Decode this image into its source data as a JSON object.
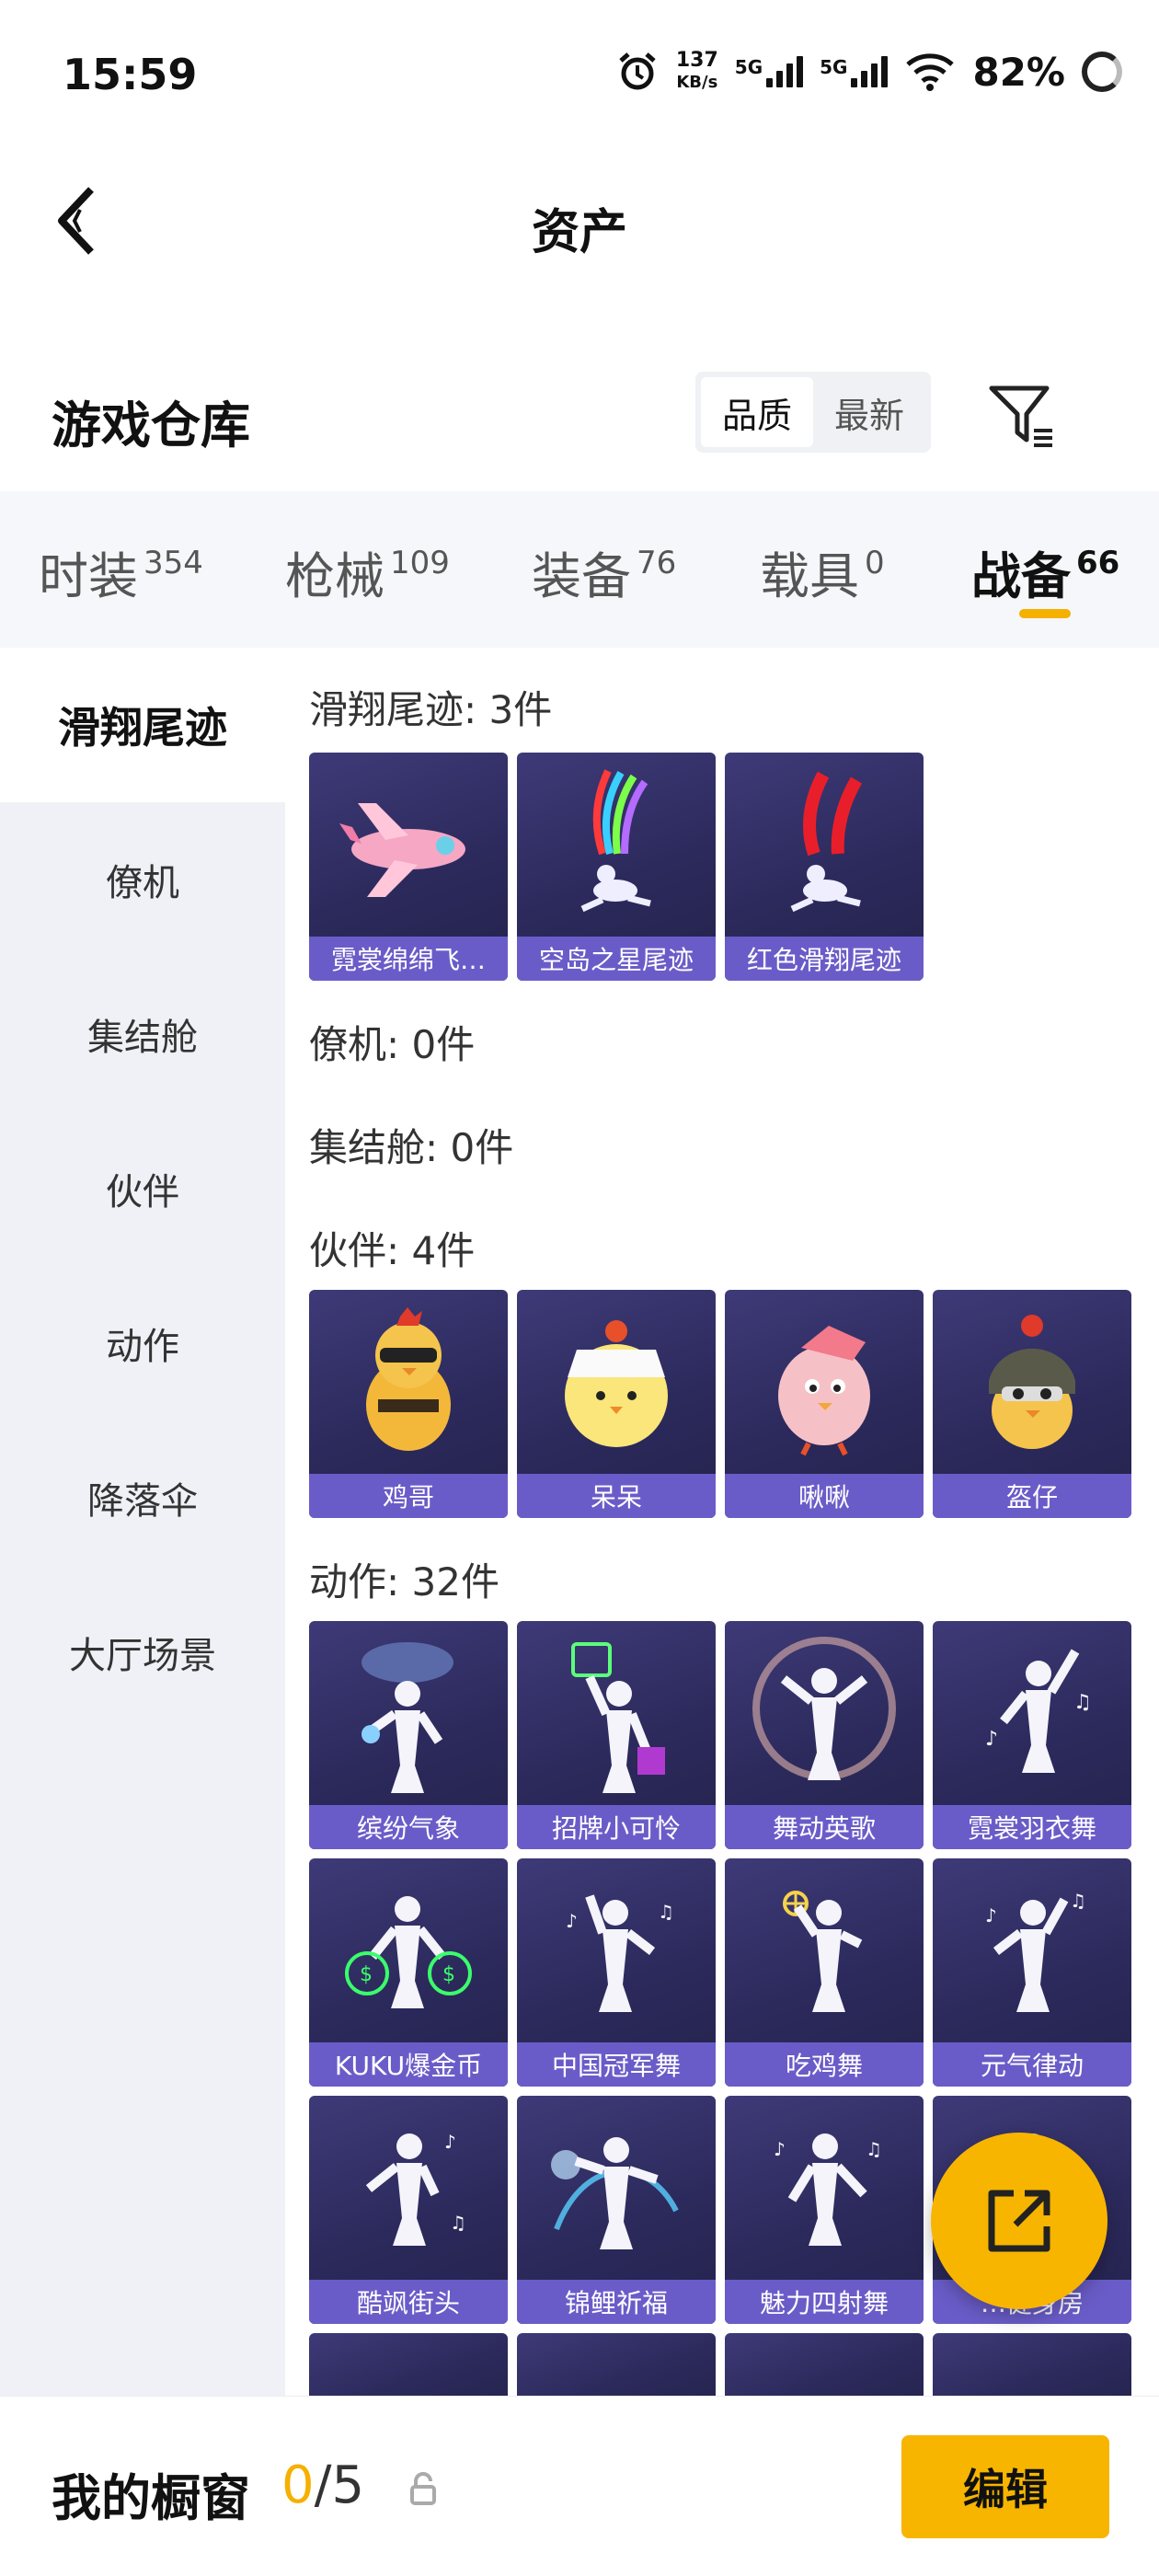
{
  "status_bar": {
    "time": "15:59",
    "speed_value": "137",
    "speed_unit": "KB/s",
    "net1": "5G",
    "net2": "5G",
    "battery": "82%"
  },
  "header": {
    "title": "资产"
  },
  "warehouse": {
    "title": "游戏仓库",
    "sort_quality": "品质",
    "sort_latest": "最新"
  },
  "tabs": [
    {
      "label": "时装",
      "count": "354"
    },
    {
      "label": "枪械",
      "count": "109"
    },
    {
      "label": "装备",
      "count": "76"
    },
    {
      "label": "载具",
      "count": "0"
    },
    {
      "label": "战备",
      "count": "66"
    }
  ],
  "sidebar": {
    "items": [
      "滑翔尾迹",
      "僚机",
      "集结舱",
      "伙伴",
      "动作",
      "降落伞",
      "大厅场景"
    ]
  },
  "sections": {
    "glide": {
      "title": "滑翔尾迹: 3件",
      "items": [
        "霓裳绵绵飞…",
        "空岛之星尾迹",
        "红色滑翔尾迹"
      ]
    },
    "wingman": {
      "title": "僚机: 0件"
    },
    "pod": {
      "title": "集结舱: 0件"
    },
    "partner": {
      "title": "伙伴: 4件",
      "items": [
        "鸡哥",
        "呆呆",
        "啾啾",
        "盔仔"
      ]
    },
    "emote": {
      "title": "动作: 32件",
      "items": [
        "缤纷气象",
        "招牌小可怜",
        "舞动英歌",
        "霓裳羽衣舞",
        "KUKU爆金币",
        "中国冠军舞",
        "吃鸡舞",
        "元气律动",
        "酷飒街头",
        "锦鲤祈福",
        "魅力四射舞",
        "…健身房"
      ]
    }
  },
  "bottom": {
    "label": "我的橱窗",
    "current": "0",
    "total": "/5",
    "edit": "编辑"
  },
  "colors": {
    "accent": "#f7b500",
    "card_label": "#6a5cc8",
    "card_bg": "#2c2a5c"
  }
}
